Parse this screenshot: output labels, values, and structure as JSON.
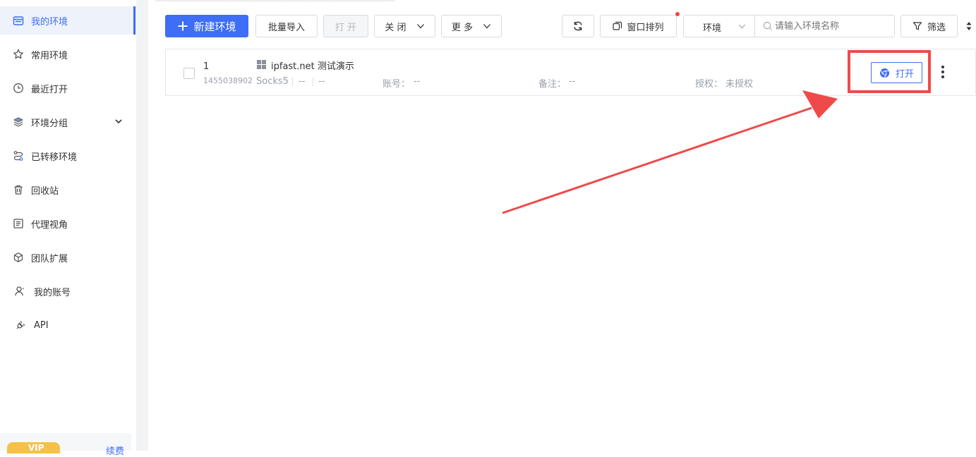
{
  "sidebar": {
    "items": [
      {
        "label": "我的环境",
        "icon": "store-icon",
        "active": true
      },
      {
        "label": "常用环境",
        "icon": "star-icon"
      },
      {
        "label": "最近打开",
        "icon": "clock-icon"
      },
      {
        "label": "环境分组",
        "icon": "layers-icon",
        "expandable": true
      },
      {
        "label": "已转移环境",
        "icon": "transfer-icon"
      },
      {
        "label": "回收站",
        "icon": "trash-icon"
      },
      {
        "label": "代理视角",
        "icon": "proxy-view-icon"
      },
      {
        "label": "团队扩展",
        "icon": "cube-icon"
      },
      {
        "label": "我的账号",
        "icon": "user-icon"
      },
      {
        "label": "API",
        "icon": "plug-icon"
      }
    ],
    "vip_label": "VIP",
    "renew_label": "续费"
  },
  "toolbar": {
    "new_env": "新建环境",
    "batch_import": "批量导入",
    "open": "打 开",
    "close": "关 闭",
    "more": "更 多",
    "window_arrange": "窗口排列",
    "env_select": "环境",
    "search_placeholder": "请输入环境名称",
    "filter": "筛选"
  },
  "env_row": {
    "index": "1",
    "id": "1455038902",
    "name": "ipfast.net 测试演示",
    "proxy_type": "Socks5",
    "proxy_ip": "--",
    "proxy_region": "--",
    "account_label": "账号：",
    "account_value": "--",
    "remark_label": "备注：",
    "remark_value": "--",
    "auth_label": "授权：",
    "auth_value": "未授权",
    "open_button": "打开"
  },
  "colors": {
    "accent": "#3d6ef5",
    "highlight": "#ef4a4a",
    "notification_dot": "#f24444"
  }
}
